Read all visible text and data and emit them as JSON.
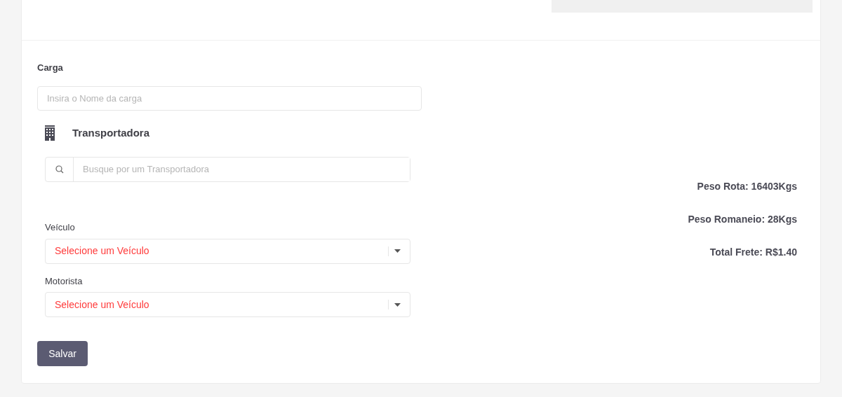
{
  "carga": {
    "label": "Carga",
    "placeholder": "Insira o Nome da carga"
  },
  "transportadora": {
    "title": "Transportadora",
    "placeholder": "Busque por um Transportadora"
  },
  "selects": [
    {
      "label": "Veículo",
      "value": "Selecione um Veículo"
    },
    {
      "label": "Motorista",
      "value": "Selecione um Veículo"
    }
  ],
  "save_button": "Salvar",
  "summary": [
    "Peso Rota: 16403Kgs",
    "Peso Romaneio: 28Kgs",
    "Total Frete: R$1.40"
  ]
}
